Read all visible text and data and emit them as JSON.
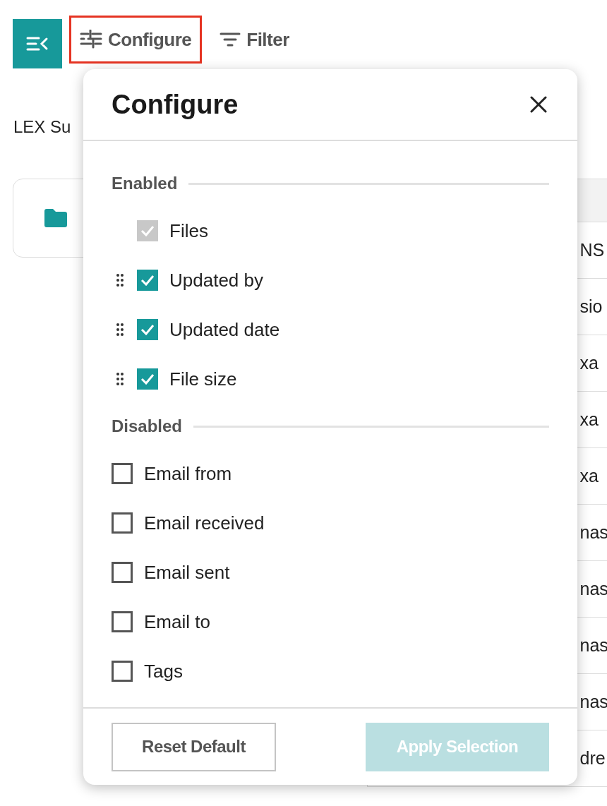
{
  "toolbar": [
    {
      "kind": "collapse",
      "highlighted": false
    },
    {
      "kind": "configure",
      "label": "Configure",
      "highlighted": true
    },
    {
      "kind": "filter",
      "label": "Filter",
      "highlighted": false
    }
  ],
  "page_title": "LEX Su",
  "table": {
    "rows": [
      "NS",
      "sio",
      "xa",
      "xa",
      "xa",
      "nas",
      "nas",
      "nas",
      "nas",
      "dre"
    ]
  },
  "popover": {
    "title": "Configure",
    "sections": [
      {
        "heading": "Enabled",
        "items": [
          {
            "label": "Files",
            "checked": true,
            "disabled": true,
            "draggable": false
          },
          {
            "label": "Updated by",
            "checked": true,
            "disabled": false,
            "draggable": true
          },
          {
            "label": "Updated date",
            "checked": true,
            "disabled": false,
            "draggable": true
          },
          {
            "label": "File size",
            "checked": true,
            "disabled": false,
            "draggable": true
          }
        ]
      },
      {
        "heading": "Disabled",
        "items": [
          {
            "label": "Email from",
            "checked": false,
            "disabled": false,
            "draggable": false
          },
          {
            "label": "Email received",
            "checked": false,
            "disabled": false,
            "draggable": false
          },
          {
            "label": "Email sent",
            "checked": false,
            "disabled": false,
            "draggable": false
          },
          {
            "label": "Email to",
            "checked": false,
            "disabled": false,
            "draggable": false
          },
          {
            "label": "Tags",
            "checked": false,
            "disabled": false,
            "draggable": false
          }
        ]
      }
    ],
    "buttons": [
      {
        "kind": "secondary",
        "label": "Reset Default",
        "disabled": false
      },
      {
        "kind": "primary",
        "label": "Apply Selection",
        "disabled": true
      }
    ]
  }
}
